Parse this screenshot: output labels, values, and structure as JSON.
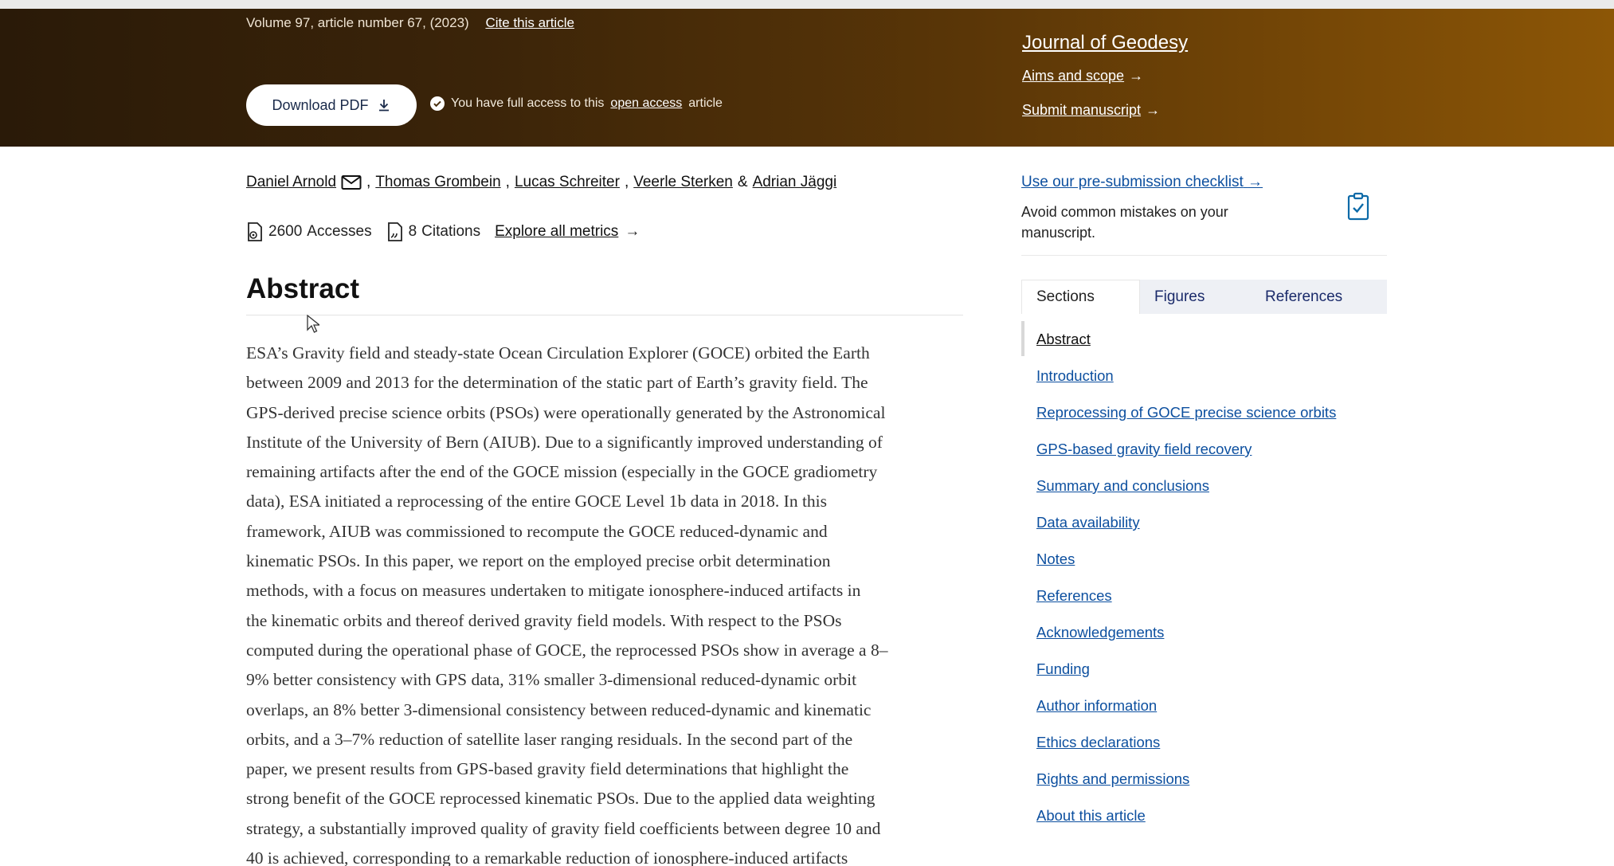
{
  "article_meta": {
    "volume_line": "Volume 97, article number 67, (2023)",
    "cite_label": "Cite this article"
  },
  "download": {
    "label": "Download PDF"
  },
  "access": {
    "prefix": "You have full access to this",
    "link": "open access",
    "suffix": "article"
  },
  "journal": {
    "title": "Journal of Geodesy",
    "aims": "Aims and scope",
    "submit": "Submit manuscript",
    "arrow": "→"
  },
  "authors": [
    "Daniel Arnold",
    "Thomas Grombein",
    "Lucas Schreiter",
    "Veerle Sterken",
    "Adrian Jäggi"
  ],
  "authors_separators": [
    ",",
    ",",
    ",",
    "&"
  ],
  "metrics": {
    "accesses_count": "2600",
    "accesses_label": "Accesses",
    "citations_count": "8",
    "citations_label": "Citations",
    "explore": "Explore all metrics",
    "arrow": "→"
  },
  "abstract": {
    "heading": "Abstract",
    "lines": [
      "ESA’s Gravity field and steady-state Ocean Circulation Explorer (GOCE) orbited the Earth",
      "between 2009 and 2013 for the determination of the static part of Earth’s gravity field. The",
      "GPS-derived precise science orbits (PSOs) were operationally generated by the Astronomical",
      "Institute of the University of Bern (AIUB). Due to a significantly improved understanding of",
      "remaining artifacts after the end of the GOCE mission (especially in the GOCE gradiometry",
      "data), ESA initiated a reprocessing of the entire GOCE Level 1b data in 2018. In this",
      "framework, AIUB was commissioned to recompute the GOCE reduced-dynamic and",
      "kinematic PSOs. In this paper, we report on the employed precise orbit determination",
      "methods, with a focus on measures undertaken to mitigate ionosphere-induced artifacts in",
      "the kinematic orbits and thereof derived gravity field models. With respect to the PSOs",
      "computed during the operational phase of GOCE, the reprocessed PSOs show in average a 8–",
      "9% better consistency with GPS data, 31% smaller 3-dimensional reduced-dynamic orbit",
      "overlaps, an 8% better 3-dimensional consistency between reduced-dynamic and kinematic",
      "orbits, and a 3–7% reduction of satellite laser ranging residuals. In the second part of the",
      "paper, we present results from GPS-based gravity field determinations that highlight the",
      "strong benefit of the GOCE reprocessed kinematic PSOs. Due to the applied data weighting",
      "strategy, a substantially improved quality of gravity field coefficients between degree 10 and",
      "40 is achieved, corresponding to a remarkable reduction of ionosphere-induced artifacts"
    ]
  },
  "sidebar": {
    "checklist_link": "Use our pre-submission checklist",
    "checklist_arrow": "→",
    "checklist_desc": "Avoid common mistakes on your manuscript.",
    "tabs": [
      "Sections",
      "Figures",
      "References"
    ],
    "toc": [
      "Abstract",
      "Introduction",
      "Reprocessing of GOCE precise science orbits",
      "GPS-based gravity field recovery",
      "Summary and conclusions",
      "Data availability",
      "Notes",
      "References",
      "Acknowledgements",
      "Funding",
      "Author information",
      "Ethics declarations",
      "Rights and permissions",
      "About this article"
    ]
  },
  "colors": {
    "banner_start": "#2a1a08",
    "banner_end": "#8c5606",
    "link_blue": "#0c4f9f"
  }
}
